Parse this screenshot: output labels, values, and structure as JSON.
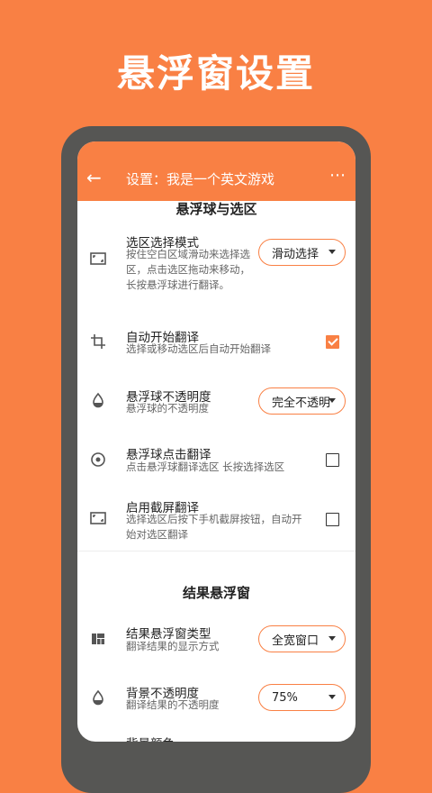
{
  "headline": "悬浮窗设置",
  "appbar": {
    "back_icon": "arrow-left",
    "title": "设置：我是一个英文游戏",
    "more_icon": "more-horizontal"
  },
  "section_float": {
    "title": "悬浮球与选区",
    "items": [
      {
        "title": "选区选择模式",
        "desc": "按住空白区域滑动来选择选区，点击选区拖动来移动，长按悬浮球进行翻译。",
        "control": "dropdown",
        "value": "滑动选择",
        "icon": "crop-frame"
      },
      {
        "title": "自动开始翻译",
        "desc": "选择或移动选区后自动开始翻译",
        "control": "checkbox",
        "checked": true,
        "icon": "crop-rotate"
      },
      {
        "title": "悬浮球不透明度",
        "desc": "悬浮球的不透明度",
        "control": "dropdown",
        "value": "完全不透明",
        "icon": "drop"
      },
      {
        "title": "悬浮球点击翻译",
        "desc": "点击悬浮球翻译选区 长按选择选区",
        "control": "checkbox",
        "checked": false,
        "icon": "target"
      },
      {
        "title": "启用截屏翻译",
        "desc": "选择选区后按下手机截屏按钮，自动开始对选区翻译",
        "control": "checkbox",
        "checked": false,
        "icon": "crop-frame"
      }
    ]
  },
  "section_result": {
    "title": "结果悬浮窗",
    "items": [
      {
        "title": "结果悬浮窗类型",
        "desc": "翻译结果的显示方式",
        "control": "dropdown",
        "value": "全宽窗口",
        "icon": "dashboard"
      },
      {
        "title": "背景不透明度",
        "desc": "翻译结果的不透明度",
        "control": "dropdown",
        "value": "75%",
        "icon": "drop"
      },
      {
        "title": "背景颜色",
        "icon": "palette"
      }
    ]
  },
  "colors": {
    "accent": "#F98044",
    "phone_frame": "#565654"
  }
}
